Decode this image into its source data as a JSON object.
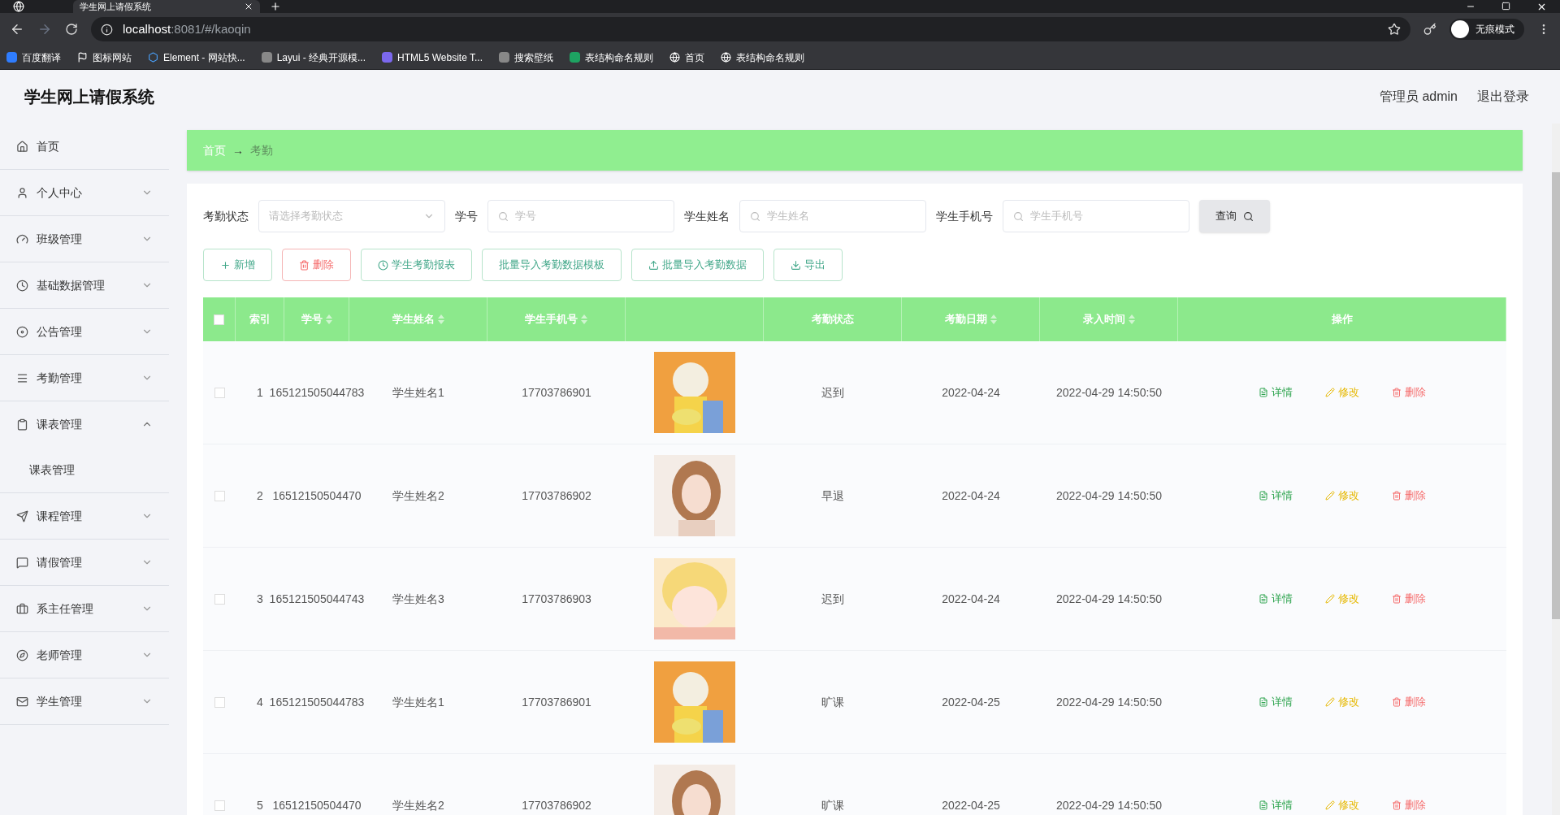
{
  "browser": {
    "tab_title": "学生网上请假系统",
    "url_host": "localhost",
    "url_rest": ":8081/#/kaoqin",
    "profile": "无痕模式",
    "bookmarks": [
      "百度翻译",
      "图标网站",
      "Element - 网站快...",
      "Layui - 经典开源模...",
      "HTML5 Website T...",
      "搜索壁纸",
      "表结构命名规则",
      "首页",
      "表结构命名规则"
    ]
  },
  "app": {
    "title": "学生网上请假系统",
    "user": "管理员 admin",
    "logout": "退出登录"
  },
  "sidebar": {
    "items": [
      {
        "label": "首页",
        "kind": "link"
      },
      {
        "label": "个人中心",
        "kind": "group",
        "expanded": false
      },
      {
        "label": "班级管理",
        "kind": "group",
        "expanded": false
      },
      {
        "label": "基础数据管理",
        "kind": "group",
        "expanded": false
      },
      {
        "label": "公告管理",
        "kind": "group",
        "expanded": false
      },
      {
        "label": "考勤管理",
        "kind": "group",
        "expanded": false
      },
      {
        "label": "课表管理",
        "kind": "group",
        "expanded": true,
        "children": [
          {
            "label": "课表管理"
          }
        ]
      },
      {
        "label": "课程管理",
        "kind": "group",
        "expanded": false
      },
      {
        "label": "请假管理",
        "kind": "group",
        "expanded": false
      },
      {
        "label": "系主任管理",
        "kind": "group",
        "expanded": false
      },
      {
        "label": "老师管理",
        "kind": "group",
        "expanded": false
      },
      {
        "label": "学生管理",
        "kind": "group",
        "expanded": false
      }
    ]
  },
  "breadcrumb": {
    "home": "首页",
    "arrow": "→",
    "current": "考勤"
  },
  "filters": [
    {
      "label": "考勤状态",
      "kind": "select",
      "placeholder": "请选择考勤状态"
    },
    {
      "label": "学号",
      "kind": "search",
      "placeholder": "学号"
    },
    {
      "label": "学生姓名",
      "kind": "search",
      "placeholder": "学生姓名"
    },
    {
      "label": "学生手机号",
      "kind": "search",
      "placeholder": "学生手机号"
    }
  ],
  "query_button": "查询",
  "actions": [
    {
      "label": "新增",
      "kind": "add"
    },
    {
      "label": "删除",
      "kind": "delete"
    },
    {
      "label": "学生考勤报表",
      "kind": "report"
    },
    {
      "label": "批量导入考勤数据模板",
      "kind": "plain"
    },
    {
      "label": "批量导入考勤数据",
      "kind": "upload"
    },
    {
      "label": "导出",
      "kind": "download"
    }
  ],
  "table": {
    "all_checked": false,
    "columns": [
      {
        "label": "索引",
        "sortable": false
      },
      {
        "label": "学号",
        "sortable": true
      },
      {
        "label": "学生姓名",
        "sortable": true
      },
      {
        "label": "学生手机号",
        "sortable": true
      },
      {
        "sortable": false
      },
      {
        "label": "考勤状态",
        "sortable": false
      },
      {
        "label": "考勤日期",
        "sortable": true
      },
      {
        "label": "录入时间",
        "sortable": true
      },
      {
        "label": "操作",
        "sortable": false
      }
    ],
    "rows": [
      {
        "checked": false,
        "index": "1",
        "student_no": "165121505044783",
        "name": "学生姓名1",
        "phone": "17703786901",
        "photo": {
          "kind": "picture"
        },
        "status": "迟到",
        "date": "2022-04-24",
        "created": "2022-04-29 14:50:50",
        "actions": [
          "详情",
          "修改",
          "删除"
        ]
      },
      {
        "checked": false,
        "index": "2",
        "student_no": "16512150504470",
        "name": "学生姓名2",
        "phone": "17703786902",
        "photo": {
          "kind": "picture"
        },
        "status": "早退",
        "date": "2022-04-24",
        "created": "2022-04-29 14:50:50",
        "actions": [
          "详情",
          "修改",
          "删除"
        ]
      },
      {
        "checked": false,
        "index": "3",
        "student_no": "165121505044743",
        "name": "学生姓名3",
        "phone": "17703786903",
        "photo": {
          "kind": "picture"
        },
        "status": "迟到",
        "date": "2022-04-24",
        "created": "2022-04-29 14:50:50",
        "actions": [
          "详情",
          "修改",
          "删除"
        ]
      },
      {
        "checked": false,
        "index": "4",
        "student_no": "165121505044783",
        "name": "学生姓名1",
        "phone": "17703786901",
        "photo": {
          "kind": "picture"
        },
        "status": "旷课",
        "date": "2022-04-25",
        "created": "2022-04-29 14:50:50",
        "actions": [
          "详情",
          "修改",
          "删除"
        ]
      },
      {
        "checked": false,
        "index": "5",
        "student_no": "16512150504470",
        "name": "学生姓名2",
        "phone": "17703786902",
        "photo": {
          "kind": "picture"
        },
        "status": "旷课",
        "date": "2022-04-25",
        "created": "2022-04-29 14:50:50",
        "actions": [
          "详情",
          "修改",
          "删除"
        ]
      }
    ]
  }
}
